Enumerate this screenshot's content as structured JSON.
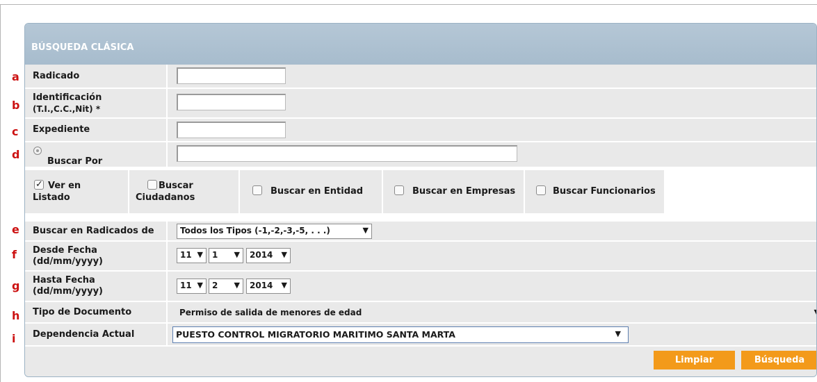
{
  "panel": {
    "title": "BÚSQUEDA CLÁSICA"
  },
  "letters": [
    "a",
    "b",
    "c",
    "d",
    "e",
    "f",
    "g",
    "h",
    "i"
  ],
  "fields": {
    "radicado": {
      "label": "Radicado",
      "value": ""
    },
    "identificacion": {
      "label": "Identificación",
      "sublabel": "(T.I.,C.C.,Nit) *",
      "value": ""
    },
    "expediente": {
      "label": "Expediente",
      "value": ""
    },
    "buscar_por": {
      "label": "Buscar Por",
      "value": ""
    }
  },
  "options": {
    "ver_listado": {
      "line1": "Ver en",
      "line2": "Listado",
      "checked": true
    },
    "buscar_ciudadanos": {
      "line1": "Buscar",
      "line2": "Ciudadanos",
      "checked": false
    },
    "buscar_entidad": {
      "label": "Buscar en Entidad",
      "checked": false
    },
    "buscar_empresas": {
      "label": "Buscar en Empresas",
      "checked": false
    },
    "buscar_funcionarios": {
      "label": "Buscar Funcionarios",
      "checked": false
    }
  },
  "radicados_de": {
    "label": "Buscar en Radicados de",
    "value": "Todos los Tipos (-1,-2,-3,-5, . . .)"
  },
  "desde": {
    "label": "Desde Fecha",
    "sublabel": "(dd/mm/yyyy)",
    "day": "11",
    "month": "1",
    "year": "2014"
  },
  "hasta": {
    "label": "Hasta Fecha",
    "sublabel": "(dd/mm/yyyy)",
    "day": "11",
    "month": "2",
    "year": "2014"
  },
  "tipo_documento": {
    "label": "Tipo de Documento",
    "value": "Permiso de salida de menores de edad"
  },
  "dependencia": {
    "label": "Dependencia Actual",
    "value": "PUESTO CONTROL MIGRATORIO MARITIMO SANTA MARTA"
  },
  "buttons": {
    "clear": "Limpiar",
    "search": "Búsqueda"
  },
  "colors": {
    "header": "#a7bccd",
    "button": "#f39a1a",
    "row": "#e9e9e9",
    "marker": "#cc1111"
  }
}
